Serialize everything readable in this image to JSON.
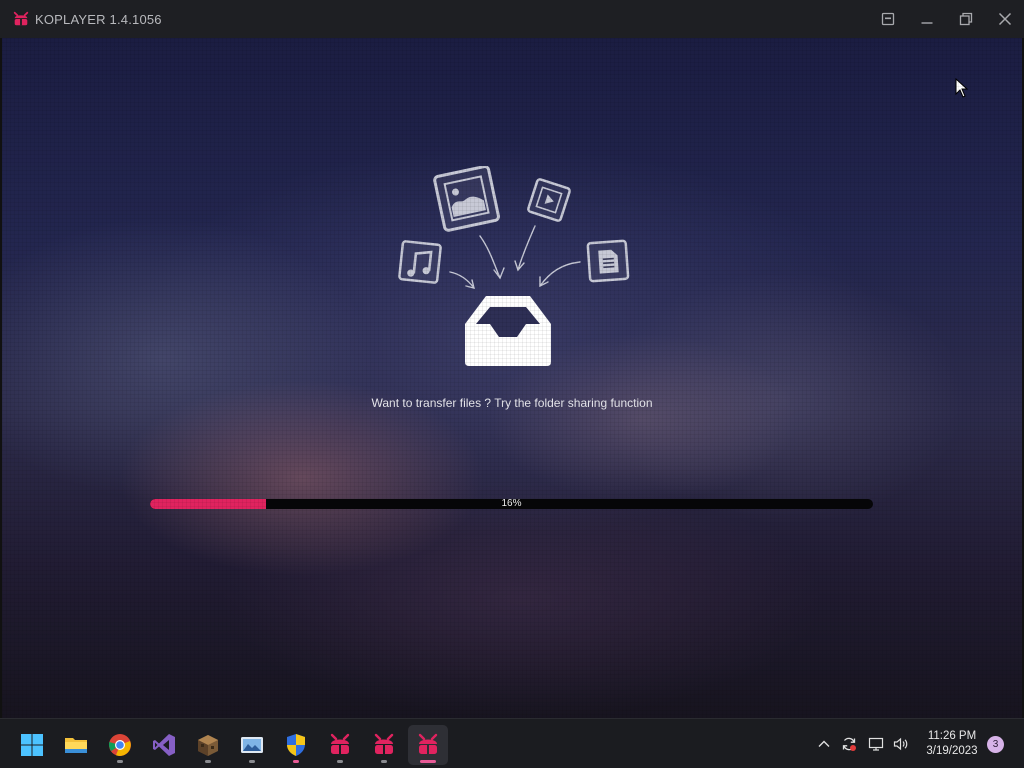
{
  "window": {
    "title": "KOPLAYER 1.4.1056",
    "logo_icon": "koplayer-logo-icon",
    "buttons": [
      "pin-window-icon",
      "minimize-icon",
      "restore-icon",
      "close-icon"
    ]
  },
  "main": {
    "tip_text": "Want to transfer files ? Try the folder sharing function",
    "illustration_icons": [
      "image-file-icon",
      "video-file-icon",
      "music-file-icon",
      "document-file-icon",
      "inbox-tray-icon"
    ],
    "progress": {
      "value": 0.16,
      "label": "16%",
      "fill_color": "#e0235f"
    }
  },
  "taskbar": {
    "apps": [
      {
        "name": "start-icon",
        "active": false,
        "dot": false
      },
      {
        "name": "file-explorer-icon",
        "active": false,
        "dot": false
      },
      {
        "name": "chrome-icon",
        "active": false,
        "dot": true
      },
      {
        "name": "visual-studio-icon",
        "active": false,
        "dot": false
      },
      {
        "name": "minecraft-icon",
        "active": false,
        "dot": true
      },
      {
        "name": "image-viewer-icon",
        "active": false,
        "dot": true
      },
      {
        "name": "security-shield-icon",
        "active": false,
        "dot": true
      },
      {
        "name": "koplayer-icon",
        "active": false,
        "dot": true
      },
      {
        "name": "koplayer-icon",
        "active": false,
        "dot": true
      },
      {
        "name": "koplayer-icon",
        "active": true,
        "dot": true
      }
    ],
    "tray_icons": [
      "chevron-up-icon",
      "sync-icon",
      "network-icon",
      "volume-icon"
    ],
    "time": "11:26 PM",
    "date": "3/19/2023",
    "notification_count": "3"
  }
}
